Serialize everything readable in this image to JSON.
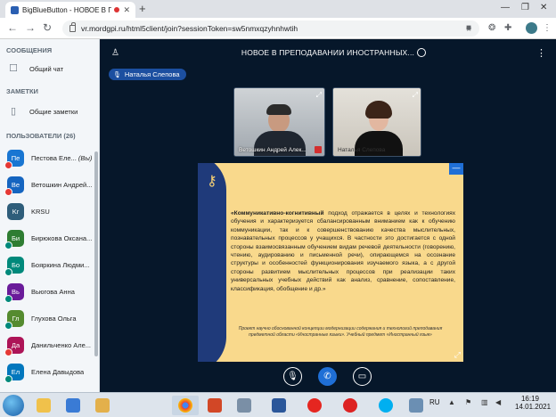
{
  "browser": {
    "tab_title": "BigBlueButton - НОВОЕ В ПР",
    "url": "vr.mordgpi.ru/html5client/join?sessionToken=sw5nmxqzyhnhwtih"
  },
  "sidebar": {
    "messages_heading": "СООБЩЕНИЯ",
    "public_chat": "Общий чат",
    "notes_heading": "ЗАМЕТКИ",
    "shared_notes": "Общие заметки",
    "users_heading": "ПОЛЬЗОВАТЕЛИ (26)",
    "users": [
      {
        "initials": "Пе",
        "name": "Пестова Еле...",
        "suffix": "(Вы)",
        "color": "#1976d2",
        "status": "#e53935"
      },
      {
        "initials": "Ве",
        "name": "Ветошкин Андрей...",
        "suffix": "",
        "color": "#1565c0",
        "status": "#e53935"
      },
      {
        "initials": "Kr",
        "name": "KRSU",
        "suffix": "",
        "color": "#2e5d7a",
        "status": ""
      },
      {
        "initials": "Би",
        "name": "Бирюкова Оксана...",
        "suffix": "",
        "color": "#2e7d32",
        "status": "#00897b"
      },
      {
        "initials": "Бо",
        "name": "Бояркина Людми...",
        "suffix": "",
        "color": "#00897b",
        "status": "#00897b"
      },
      {
        "initials": "Вь",
        "name": "Вьюгова Анна",
        "suffix": "",
        "color": "#6a1b9a",
        "status": "#00897b"
      },
      {
        "initials": "Гл",
        "name": "Глухова Ольга",
        "suffix": "",
        "color": "#558b2f",
        "status": "#00897b"
      },
      {
        "initials": "Да",
        "name": "Данильченко Але...",
        "suffix": "",
        "color": "#ad1457",
        "status": "#e53935"
      },
      {
        "initials": "Ел",
        "name": "Елена Давыдова",
        "suffix": "",
        "color": "#0277bd",
        "status": "#00897b"
      }
    ]
  },
  "main": {
    "meeting_title": "НОВОЕ В ПРЕПОДАВАНИИ ИНОСТРАННЫХ...",
    "current_speaker": "Наталья Слепова",
    "videos": [
      {
        "name": "Ветошкин Андрей Алек..."
      },
      {
        "name": "Наталья Слепова"
      }
    ],
    "slide": {
      "bold_term": "«Коммуникативно-когнитивный",
      "body": " подход отражается в целях и технологиях обучения и характеризуется сбалансированным вниманием как к обучению коммуникации, так и к совершенствованию качества мыслительных, познавательных процессов у учащихся. В частности это достигается с одной стороны взаимосвязанным обучением видам речевой деятельности (говорению, чтению, аудированию и письменной речи), опирающемся на осознание структуры и особенностей функционирования изучаемого языка, а с другой стороны развитием мыслительных процессов при реализации таких универсальных учебных действий как анализ, сравнение, сопоставление, классификация, обобщение и др.»",
      "footnote": "Проект научно обоснованной концепции модернизации содержания и технологий преподавания предметной области «Иностранные языки». Учебный предмет «Иностранный язык»",
      "min_label": "—"
    }
  },
  "taskbar": {
    "lang": "RU",
    "time": "16:19",
    "date": "14.01.2021"
  }
}
